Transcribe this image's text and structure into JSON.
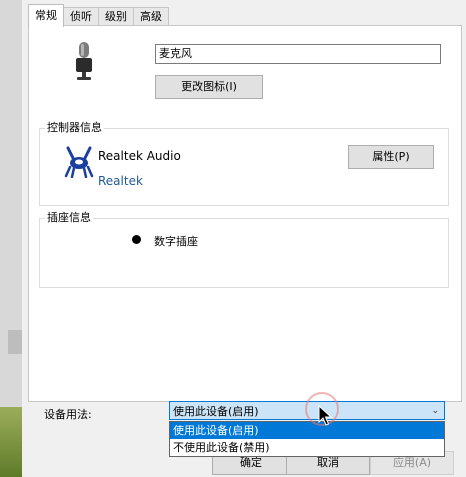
{
  "tabs": [
    "常规",
    "侦听",
    "级别",
    "高级"
  ],
  "device": {
    "name_value": "麦克风",
    "change_icon_label": "更改图标(I)"
  },
  "controller": {
    "group_title": "控制器信息",
    "name": "Realtek Audio",
    "vendor": "Realtek",
    "properties_label": "属性(P)"
  },
  "jack": {
    "group_title": "插座信息",
    "label": "数字插座"
  },
  "usage": {
    "label": "设备用法:",
    "selected": "使用此设备(启用)",
    "options": [
      "使用此设备(启用)",
      "不使用此设备(禁用)"
    ]
  },
  "buttons": {
    "ok": "确定",
    "cancel": "取消",
    "apply": "应用(A)"
  },
  "icons": {
    "microphone": "microphone-icon",
    "realtek": "realtek-crab-icon",
    "dropdown_arrow": "chevron-down-icon",
    "cursor": "mouse-pointer-icon"
  },
  "colors": {
    "selection": "#0078d7",
    "select_highlight": "#cce4f7",
    "vendor_link": "#1f5a94"
  }
}
